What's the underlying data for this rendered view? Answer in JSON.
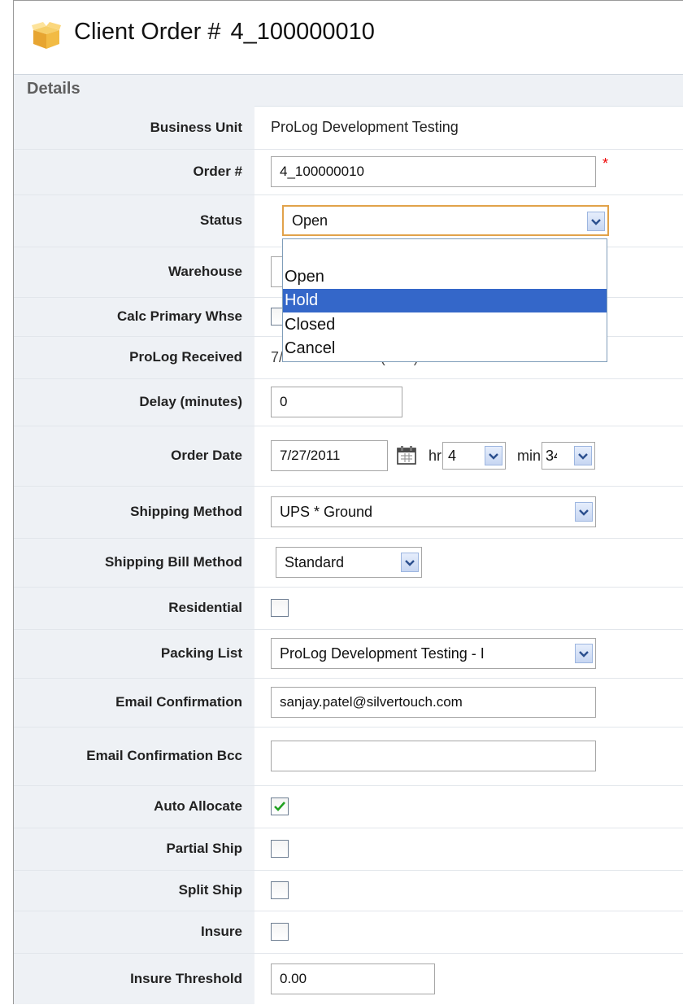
{
  "header": {
    "title_prefix": "Client Order #",
    "order_number": "4_100000010"
  },
  "details": {
    "section_title": "Details",
    "labels": {
      "business_unit": "Business Unit",
      "order_num": "Order #",
      "status": "Status",
      "warehouse": "Warehouse",
      "calc_primary_whse": "Calc Primary Whse",
      "prolog_received": "ProLog Received",
      "delay": "Delay (minutes)",
      "order_date": "Order Date",
      "shipping_method": "Shipping Method",
      "shipping_bill_method": "Shipping Bill Method",
      "residential": "Residential",
      "packing_list": "Packing List",
      "email_confirmation": "Email Confirmation",
      "email_confirmation_bcc": "Email Confirmation Bcc",
      "auto_allocate": "Auto Allocate",
      "partial_ship": "Partial Ship",
      "split_ship": "Split Ship",
      "insure": "Insure",
      "insure_threshold": "Insure Threshold"
    },
    "values": {
      "business_unit": "ProLog Development Testing",
      "order_num": "4_100000010",
      "required_mark": "*",
      "status": "Open",
      "prolog_received_partial": "7/21/11 2:38 AM (PST)",
      "delay": "0",
      "order_date": "7/27/2011",
      "hr_label": "hr",
      "hr_value": "4",
      "min_label": "min",
      "min_value": "34",
      "shipping_method": "UPS * Ground",
      "shipping_bill_method": "Standard",
      "residential": false,
      "packing_list": "ProLog Development Testing - I",
      "email_confirmation": "sanjay.patel@silvertouch.com",
      "email_confirmation_bcc": "",
      "auto_allocate": true,
      "partial_ship": false,
      "split_ship": false,
      "insure": false,
      "insure_threshold": "0.00"
    },
    "status_dropdown": {
      "options": [
        "",
        "Open",
        "Hold",
        "Closed",
        "Cancel"
      ],
      "highlighted": "Hold"
    }
  },
  "colors": {
    "highlight": "#3467c9",
    "label_bg": "#eef1f5",
    "focus_border": "#e1a24a",
    "required": "#ee0000"
  }
}
